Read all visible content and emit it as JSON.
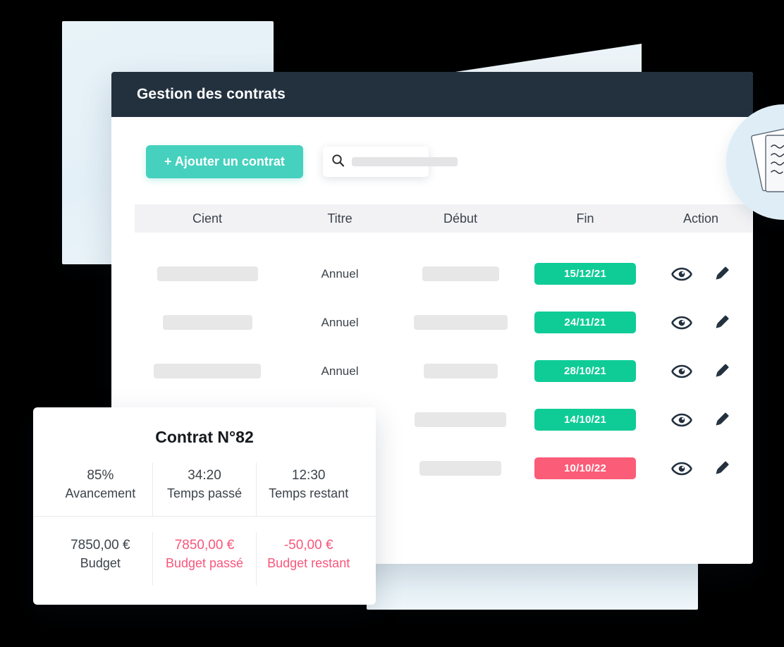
{
  "window": {
    "title": "Gestion des contrats"
  },
  "toolbar": {
    "add_button_label": "+ Ajouter un contrat",
    "search_icon": "search-icon",
    "search_value": "",
    "search_placeholder": ""
  },
  "table": {
    "columns": [
      "Cient",
      "Titre",
      "Début",
      "Fin",
      "Action"
    ],
    "rows": [
      {
        "client": "",
        "titre": "Annuel",
        "debut": "",
        "fin": "15/12/21",
        "fin_status": "green",
        "client_width": 143,
        "debut_width": 109
      },
      {
        "client": "",
        "titre": "Annuel",
        "debut": "",
        "fin": "24/11/21",
        "fin_status": "green",
        "client_width": 127,
        "debut_width": 133
      },
      {
        "client": "",
        "titre": "Annuel",
        "debut": "",
        "fin": "28/10/21",
        "fin_status": "green",
        "client_width": 152,
        "debut_width": 105
      },
      {
        "client": "",
        "titre": "",
        "debut": "",
        "fin": "14/10/21",
        "fin_status": "green",
        "client_width": 0,
        "debut_width": 130
      },
      {
        "client": "",
        "titre": "",
        "debut": "",
        "fin": "10/10/22",
        "fin_status": "pink",
        "client_width": 0,
        "debut_width": 116
      }
    ],
    "action_icons": [
      "eye-icon",
      "pencil-icon"
    ]
  },
  "doc_badge": {
    "icon": "documents-with-pencil-icon"
  },
  "contract_card": {
    "title": "Contrat N°82",
    "metrics_row1": [
      {
        "value": "85%",
        "label": "Avancement",
        "tone": "normal"
      },
      {
        "value": "34:20",
        "label": "Temps passé",
        "tone": "normal"
      },
      {
        "value": "12:30",
        "label": "Temps restant",
        "tone": "normal"
      }
    ],
    "metrics_row2": [
      {
        "value": "7850,00 €",
        "label": "Budget",
        "tone": "normal"
      },
      {
        "value": "7850,00 €",
        "label": "Budget passé",
        "tone": "pink"
      },
      {
        "value": "-50,00 €",
        "label": "Budget restant",
        "tone": "pink"
      }
    ]
  },
  "colors": {
    "titlebar": "#23313f",
    "add_button": "#45d1be",
    "badge_green": "#0fcc97",
    "badge_pink": "#fb5c77",
    "deco_blue": "#e7f2f8",
    "card_pink_text": "#f8567a"
  }
}
